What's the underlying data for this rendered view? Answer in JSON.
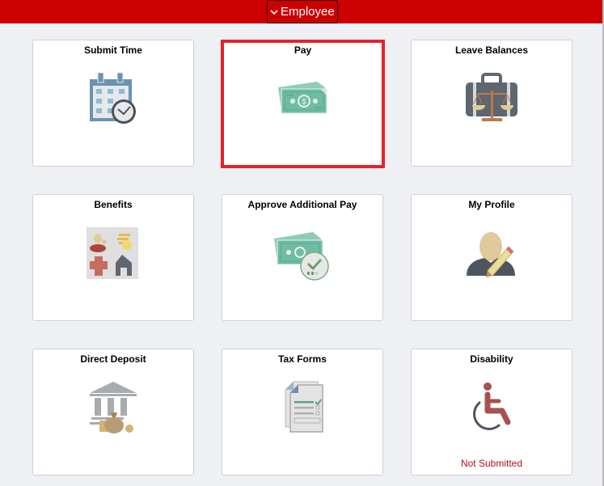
{
  "header": {
    "nav_label": "Employee",
    "background_color": "#cc0000"
  },
  "tiles": [
    {
      "title": "Submit Time",
      "icon": "calendar-clock-icon"
    },
    {
      "title": "Pay",
      "icon": "money-icon",
      "selected": true
    },
    {
      "title": "Leave Balances",
      "icon": "briefcase-scales-icon"
    },
    {
      "title": "Benefits",
      "icon": "benefits-icon"
    },
    {
      "title": "Approve Additional Pay",
      "icon": "money-approve-icon"
    },
    {
      "title": "My Profile",
      "icon": "profile-edit-icon"
    },
    {
      "title": "Direct Deposit",
      "icon": "bank-icon"
    },
    {
      "title": "Tax Forms",
      "icon": "tax-form-icon"
    },
    {
      "title": "Disability",
      "icon": "wheelchair-icon",
      "status": "Not Submitted"
    }
  ],
  "colors": {
    "selection_border": "#e8202a",
    "status_text": "#b0101a"
  }
}
